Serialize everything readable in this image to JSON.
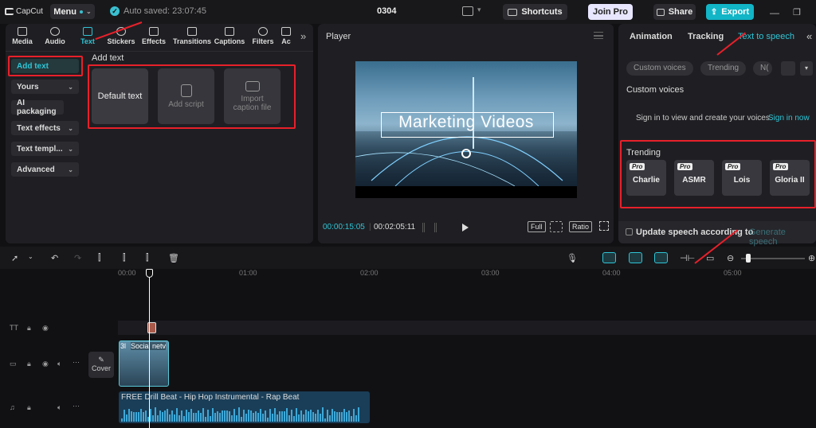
{
  "app": {
    "logo": "CapCut",
    "menu": "Menu",
    "autosave": "Auto saved: 23:07:45",
    "project": "0304"
  },
  "toolbar": {
    "shortcuts": "Shortcuts",
    "join_pro": "Join Pro",
    "share": "Share",
    "export": "Export"
  },
  "media_tabs": [
    "Media",
    "Audio",
    "Text",
    "Stickers",
    "Effects",
    "Transitions",
    "Captions",
    "Filters",
    "Ac"
  ],
  "sidebar": {
    "items": [
      {
        "label": "Add text"
      },
      {
        "label": "Yours"
      },
      {
        "label": "AI packaging"
      },
      {
        "label": "Text effects"
      },
      {
        "label": "Text templ..."
      },
      {
        "label": "Advanced"
      }
    ]
  },
  "add_text": {
    "title": "Add text",
    "cards": [
      "Default text",
      "Add script",
      "Import caption file"
    ]
  },
  "player": {
    "title": "Player",
    "overlay_text": "Marketing Videos",
    "current_time": "00:00:15:05",
    "total_time": "00:02:05:11",
    "full": "Full",
    "ratio": "Ratio"
  },
  "right": {
    "tabs": [
      "Animation",
      "Tracking",
      "Text to speech"
    ],
    "chips": [
      "Custom voices",
      "Trending",
      "N("
    ],
    "custom_voices_title": "Custom voices",
    "signin_text": "Sign in to view and create your voices.",
    "signin_link": "Sign in now",
    "trending_title": "Trending",
    "voices": [
      "Charlie",
      "ASMR",
      "Lois",
      "Gloria II"
    ],
    "pro_badge": "Pro",
    "update_label": "Update speech according to",
    "generate": "Generate speech"
  },
  "timeline": {
    "ruler": [
      "00:00",
      "01:00",
      "02:00",
      "03:00",
      "04:00",
      "05:00"
    ],
    "cover": "Cover",
    "video_clip": "Social netv",
    "video_clip_prefix": "3l",
    "audio_clip": "FREE Drill Beat - Hip Hop Instrumental - Rap Beat"
  },
  "colors": {
    "accent": "#11b5c6",
    "annotation": "#e8202a"
  }
}
